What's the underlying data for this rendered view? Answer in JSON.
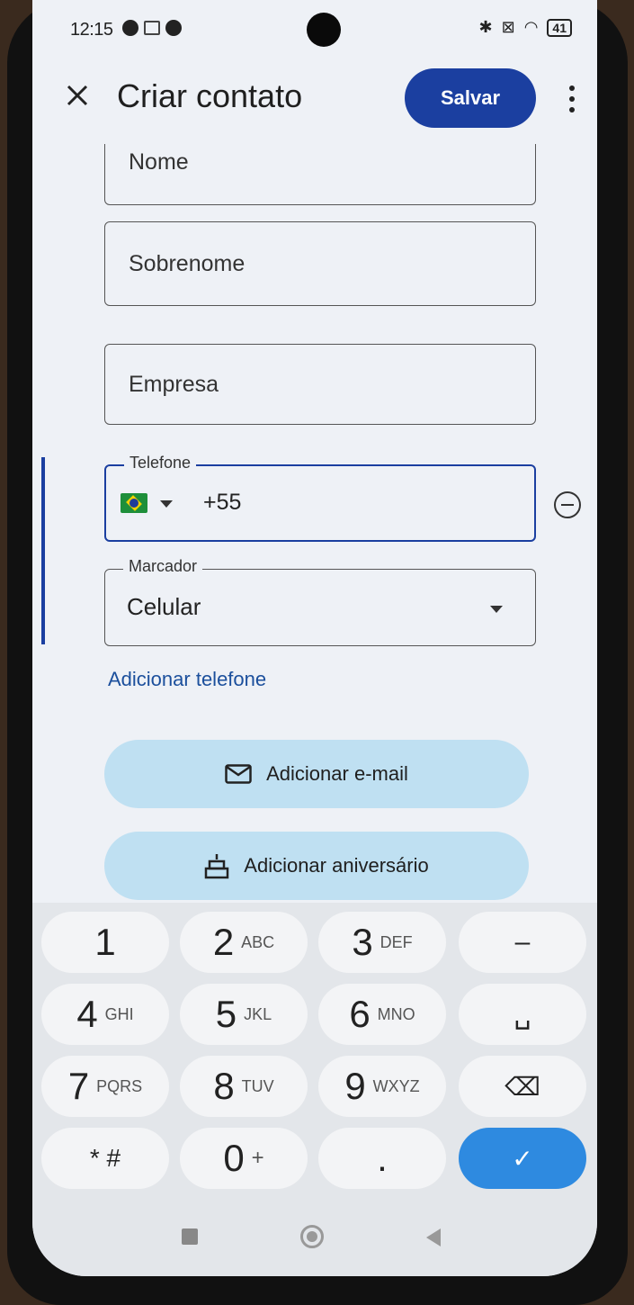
{
  "status": {
    "time": "12:15",
    "battery": "41"
  },
  "appbar": {
    "title": "Criar contato",
    "save_label": "Salvar"
  },
  "fields": {
    "first_name": {
      "placeholder": "Nome"
    },
    "last_name": {
      "placeholder": "Sobrenome"
    },
    "company": {
      "placeholder": "Empresa"
    },
    "phone": {
      "legend": "Telefone",
      "value": "+55",
      "country_flag": "brazil-flag-icon"
    },
    "label": {
      "legend": "Marcador",
      "value": "Celular"
    }
  },
  "actions": {
    "add_phone": "Adicionar telefone",
    "add_email": "Adicionar e-mail",
    "add_birthday": "Adicionar aniversário"
  },
  "keypad": {
    "keys": [
      {
        "digit": "1",
        "letters": ""
      },
      {
        "digit": "2",
        "letters": "ABC"
      },
      {
        "digit": "3",
        "letters": "DEF"
      },
      {
        "digit": "–",
        "letters": ""
      },
      {
        "digit": "4",
        "letters": "GHI"
      },
      {
        "digit": "5",
        "letters": "JKL"
      },
      {
        "digit": "6",
        "letters": "MNO"
      },
      {
        "digit": "␣",
        "letters": ""
      },
      {
        "digit": "7",
        "letters": "PQRS"
      },
      {
        "digit": "8",
        "letters": "TUV"
      },
      {
        "digit": "9",
        "letters": "WXYZ"
      },
      {
        "digit": "⌫",
        "letters": ""
      },
      {
        "digit": "* #",
        "letters": ""
      },
      {
        "digit": "0",
        "letters": "+"
      },
      {
        "digit": ".",
        "letters": ""
      },
      {
        "digit": "✓",
        "letters": ""
      }
    ]
  },
  "colors": {
    "accent": "#1b3fa0",
    "pill": "#bfe0f2",
    "confirm": "#2e8ae0"
  }
}
